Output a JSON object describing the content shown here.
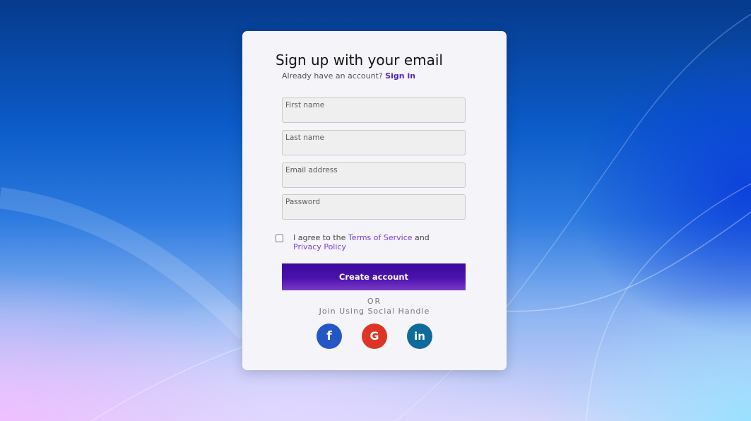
{
  "form": {
    "title": "Sign up with your email",
    "signin_prompt": "Already have an account?",
    "signin_link": "Sign in",
    "fields": {
      "first_name": "First name",
      "last_name": "Last name",
      "email": "Email address",
      "password": "Password"
    },
    "agree": {
      "prefix": "I agree to the",
      "terms": "Terms of Service",
      "and": "and",
      "privacy": "Privacy Policy"
    },
    "submit_label": "Create account",
    "or_label": "OR",
    "social_label": "Join Using Social Handle",
    "social": {
      "facebook_glyph": "f",
      "google_glyph": "G",
      "linkedin_glyph": "in"
    }
  },
  "colors": {
    "accent": "#4a2bb5",
    "link": "#7a3fd6",
    "facebook": "#2457c5",
    "google": "#dc3525",
    "linkedin": "#0e6a9a"
  }
}
